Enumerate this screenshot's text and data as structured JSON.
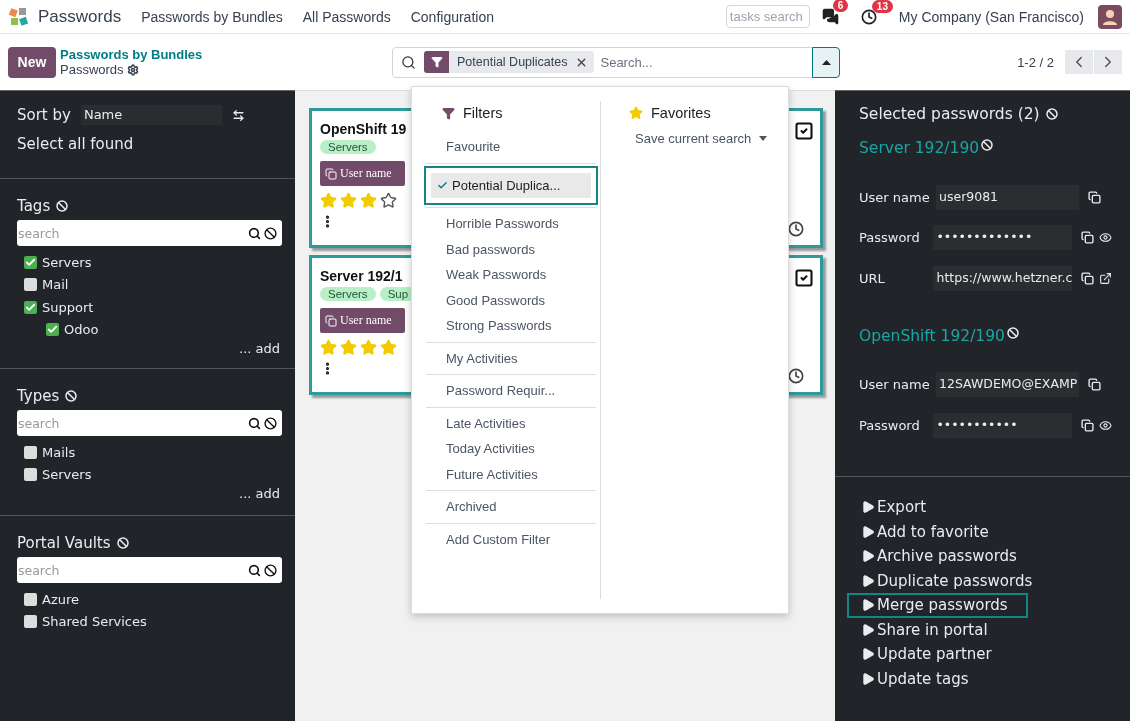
{
  "topbar": {
    "app": "Passwords",
    "menu": [
      "Passwords by Bundles",
      "All Passwords",
      "Configuration"
    ],
    "tasks_search": {
      "placeholder": "tasks search"
    },
    "messages_count": "6",
    "activities_count": "13",
    "company": "My Company (San Francisco)"
  },
  "control": {
    "new_button": "New",
    "breadcrumb": "Passwords by Bundles",
    "view_title": "Passwords",
    "facet": "Potential Duplicates",
    "search": {
      "placeholder": "Search..."
    },
    "pager": "1-2 / 2"
  },
  "sidebar": {
    "sort_label": "Sort by",
    "sort_value": "Name",
    "select_all": "Select all found",
    "sections": [
      {
        "title": "Tags",
        "search_placeholder": "search",
        "add": "... add",
        "items": [
          {
            "label": "Servers",
            "checked": true
          },
          {
            "label": "Mail",
            "checked": false
          },
          {
            "label": "Support",
            "checked": true,
            "children": [
              {
                "label": "Odoo",
                "checked": true
              }
            ]
          }
        ]
      },
      {
        "title": "Types",
        "search_placeholder": "search",
        "add": "... add",
        "items": [
          {
            "label": "Mails",
            "checked": false
          },
          {
            "label": "Servers",
            "checked": false
          }
        ]
      },
      {
        "title": "Portal Vaults",
        "search_placeholder": "search",
        "items": [
          {
            "label": "Azure",
            "checked": false
          },
          {
            "label": "Shared Services",
            "checked": false
          }
        ]
      }
    ]
  },
  "cards": [
    {
      "title": "OpenShift 19",
      "tags": [
        "Servers"
      ],
      "button": "User name",
      "stars": 3,
      "checked": true
    },
    {
      "title": "Server 192/1",
      "tags": [
        "Servers",
        "Sup"
      ],
      "button": "User name",
      "stars": 4,
      "checked": true
    }
  ],
  "dropdown": {
    "filters_title": "Filters",
    "filter_groups": [
      [
        {
          "label": "Favourite",
          "selected": false
        }
      ],
      [
        {
          "label": "Potential Duplica...",
          "selected": true
        }
      ],
      [
        {
          "label": "Horrible Passwords",
          "selected": false
        },
        {
          "label": "Bad passwords",
          "selected": false
        },
        {
          "label": "Weak Passwords",
          "selected": false
        },
        {
          "label": "Good Passwords",
          "selected": false
        },
        {
          "label": "Strong Passwords",
          "selected": false
        }
      ],
      [
        {
          "label": "My Activities",
          "selected": false
        }
      ],
      [
        {
          "label": "Password Requir...",
          "selected": false
        }
      ],
      [
        {
          "label": "Late Activities",
          "selected": false
        },
        {
          "label": "Today Activities",
          "selected": false
        },
        {
          "label": "Future Activities",
          "selected": false
        }
      ],
      [
        {
          "label": "Archived",
          "selected": false
        }
      ],
      [
        {
          "label": "Add Custom Filter",
          "selected": false
        }
      ]
    ],
    "favorites_title": "Favorites",
    "save_search": "Save current search"
  },
  "panel": {
    "title": "Selected passwords (2)",
    "records": [
      {
        "name": "Server 192/190",
        "fields": [
          {
            "label": "User name",
            "value": "user9081",
            "kind": "text"
          },
          {
            "label": "Password",
            "value": "•••••••••••••",
            "kind": "secret"
          },
          {
            "label": "URL",
            "value": "https://www.hetzner.c",
            "kind": "link"
          }
        ]
      },
      {
        "name": "OpenShift 192/190",
        "fields": [
          {
            "label": "User name",
            "value": "12SAWDEMO@EXAMP",
            "kind": "text"
          },
          {
            "label": "Password",
            "value": "•••••••••••",
            "kind": "secret"
          }
        ]
      }
    ],
    "actions": [
      {
        "label": "Export",
        "selected": false
      },
      {
        "label": "Add to favorite",
        "selected": false
      },
      {
        "label": "Archive passwords",
        "selected": false
      },
      {
        "label": "Duplicate passwords",
        "selected": false
      },
      {
        "label": "Merge passwords",
        "selected": true
      },
      {
        "label": "Share in portal",
        "selected": false
      },
      {
        "label": "Update partner",
        "selected": false
      },
      {
        "label": "Update tags",
        "selected": false
      }
    ]
  }
}
